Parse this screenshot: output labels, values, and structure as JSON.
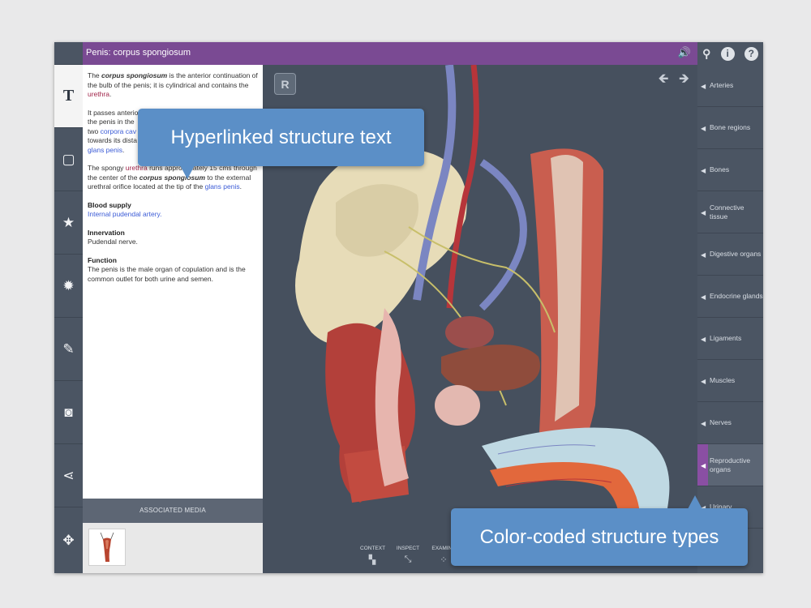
{
  "header": {
    "title": "Penis: corpus spongiosum"
  },
  "toolbar": {
    "items": [
      {
        "name": "text-tool",
        "icon": "text-icon",
        "glyph": "T"
      },
      {
        "name": "frame-tool",
        "icon": "frame-icon",
        "glyph": "▢"
      },
      {
        "name": "favorites-tool",
        "icon": "star-icon",
        "glyph": "★"
      },
      {
        "name": "settings-tool",
        "icon": "gear-icon",
        "glyph": "✹"
      },
      {
        "name": "tools-tool",
        "icon": "pencil-ruler-icon",
        "glyph": "✎"
      },
      {
        "name": "camera-tool",
        "icon": "camera-icon",
        "glyph": "◙"
      },
      {
        "name": "share-tool",
        "icon": "share-icon",
        "glyph": "⋖"
      },
      {
        "name": "move-tool",
        "icon": "move-icon",
        "glyph": "✥"
      }
    ]
  },
  "top_icons": {
    "search": "⚲",
    "info": "i",
    "help": "?"
  },
  "textpanel": {
    "p1_pre": "The ",
    "p1_term": "corpus spongiosum",
    "p1_mid": " is the anterior continuation of the bulb of the penis; it is cylindrical and contains the ",
    "p1_link": "urethra",
    "p1_post": ".",
    "p2_pre": "It passes anterior",
    "p2_line2": "the penis in the",
    "p2_line3_pre": "two ",
    "p2_link1": "corpora cav",
    "p2_line4": "towards its dista",
    "p2_link2": "glans penis",
    "p2_post": ".",
    "p3_pre": "The spongy ",
    "p3_link": "urethra",
    "p3_mid": " runs approximately 15 cms through the center of the ",
    "p3_term": "corpus spongiosum",
    "p3_mid2": " to the external urethral orifice located at the tip of the ",
    "p3_link2": "glans penis",
    "p3_post": ".",
    "blood_heading": "Blood supply",
    "blood_link": "Internal pudendal artery.",
    "innervation_heading": "Innervation",
    "innervation_text": "Pudendal nerve.",
    "function_heading": "Function",
    "function_text": "The penis is the male organ of copulation and is the common outlet for both urine and semen."
  },
  "associated_media": {
    "label": "ASSOCIATED MEDIA"
  },
  "viewport": {
    "badge": "R",
    "back_arrow": "🡸",
    "forward_arrow": "🡺",
    "modes": [
      {
        "label": "CONTEXT",
        "icon": "context-icon",
        "glyph": "▚"
      },
      {
        "label": "INSPECT",
        "icon": "inspect-icon",
        "glyph": "⤡"
      },
      {
        "label": "EXAMINE",
        "icon": "examine-icon",
        "glyph": "⁘"
      }
    ]
  },
  "categories": [
    {
      "label": "Arteries"
    },
    {
      "label": "Bone regions"
    },
    {
      "label": "Bones"
    },
    {
      "label": "Connective tissue"
    },
    {
      "label": "Digestive organs"
    },
    {
      "label": "Endocrine glands"
    },
    {
      "label": "Ligaments"
    },
    {
      "label": "Muscles"
    },
    {
      "label": "Nerves"
    },
    {
      "label": "Reproductive organs"
    },
    {
      "label": "Urinary"
    }
  ],
  "callouts": {
    "top": "Hyperlinked structure text",
    "bottom": "Color-coded structure types"
  },
  "colors": {
    "header_purple": "#7a4a93",
    "category_active": "#8a4fa3",
    "callout_blue": "#5b8fc7",
    "link_blue": "#3b5bd6",
    "link_red": "#a0254a"
  }
}
